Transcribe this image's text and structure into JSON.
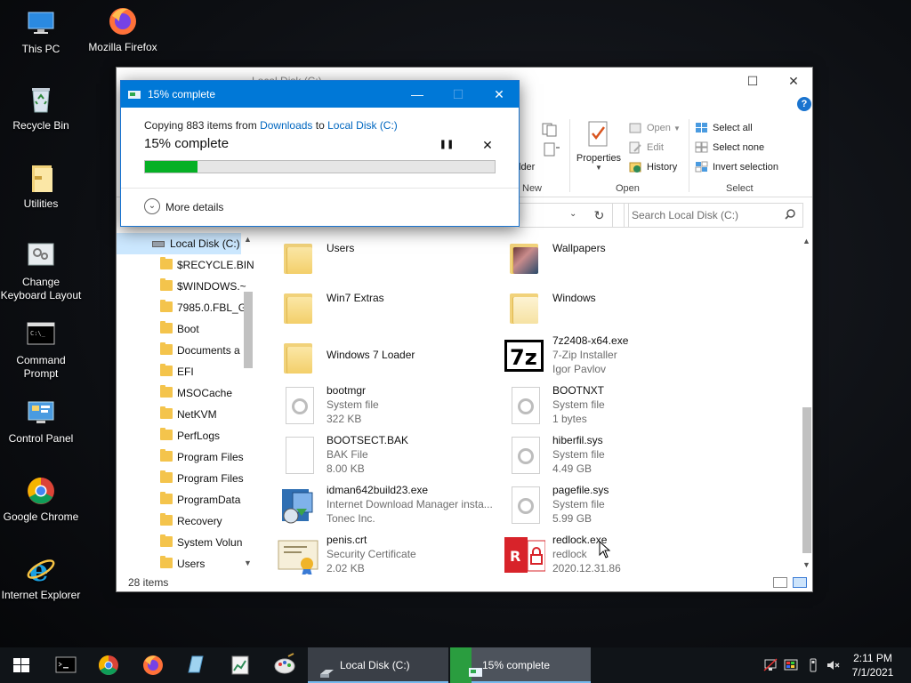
{
  "desktop": {
    "icons": [
      {
        "label": "This PC"
      },
      {
        "label": "Mozilla Firefox"
      },
      {
        "label": "Recycle Bin"
      },
      {
        "label": "Utilities"
      },
      {
        "label": "Change Keyboard Layout"
      },
      {
        "label": "Command Prompt"
      },
      {
        "label": "Control Panel"
      },
      {
        "label": "Google Chrome"
      },
      {
        "label": "Internet Explorer"
      }
    ]
  },
  "explorer": {
    "title": "Local Disk (C:)",
    "ribbon": {
      "new_group_label": "New",
      "new_folder_partial": "lder",
      "properties_label": "Properties",
      "open_label": "Open",
      "edit_label": "Edit",
      "history_label": "History",
      "open_group_label": "Open",
      "select_all_label": "Select all",
      "select_none_label": "Select none",
      "invert_selection_label": "Invert selection",
      "select_group_label": "Select"
    },
    "search_placeholder": "Search Local Disk (C:)",
    "nav": {
      "root_label": "Local Disk (C:)",
      "items": [
        "$RECYCLE.BIN",
        "$WINDOWS.~",
        "7985.0.FBL_GI",
        "Boot",
        "Documents a",
        "EFI",
        "MSOCache",
        "NetKVM",
        "PerfLogs",
        "Program Files",
        "Program Files",
        "ProgramData",
        "Recovery",
        "System Volun",
        "Users"
      ]
    },
    "files": [
      {
        "name": "Users",
        "type": "",
        "meta": ""
      },
      {
        "name": "Wallpapers",
        "type": "",
        "meta": ""
      },
      {
        "name": "Win7 Extras",
        "type": "",
        "meta": ""
      },
      {
        "name": "Windows",
        "type": "",
        "meta": ""
      },
      {
        "name": "Windows 7 Loader",
        "type": "",
        "meta": ""
      },
      {
        "name": "7z2408-x64.exe",
        "type": "7-Zip Installer",
        "meta": "Igor Pavlov"
      },
      {
        "name": "bootmgr",
        "type": "System file",
        "meta": "322 KB"
      },
      {
        "name": "BOOTNXT",
        "type": "System file",
        "meta": "1 bytes"
      },
      {
        "name": "BOOTSECT.BAK",
        "type": "BAK File",
        "meta": "8.00 KB"
      },
      {
        "name": "hiberfil.sys",
        "type": "System file",
        "meta": "4.49 GB"
      },
      {
        "name": "idman642build23.exe",
        "type": "Internet Download Manager insta...",
        "meta": "Tonec Inc."
      },
      {
        "name": "pagefile.sys",
        "type": "System file",
        "meta": "5.99 GB"
      },
      {
        "name": "penis.crt",
        "type": "Security Certificate",
        "meta": "2.02 KB"
      },
      {
        "name": "redlock.exe",
        "type": "redlock",
        "meta": "2020.12.31.86"
      }
    ],
    "status": "28 items"
  },
  "copy_dialog": {
    "title": "15% complete",
    "line_prefix": "Copying 883 items from ",
    "source": "Downloads",
    "line_mid": " to ",
    "destination": "Local Disk (C:)",
    "percent_text": "15% complete",
    "progress_fraction": 0.15,
    "pause_glyph": "❚❚",
    "close_glyph": "✕",
    "more_details": "More details"
  },
  "taskbar": {
    "tasks": [
      {
        "label": "Local Disk (C:)"
      },
      {
        "label": "15% complete"
      }
    ],
    "time": "2:11 PM",
    "date": "7/1/2021"
  },
  "colors": {
    "accent": "#0078d7",
    "progress_green": "#06b025",
    "link_blue": "#0067c0"
  }
}
